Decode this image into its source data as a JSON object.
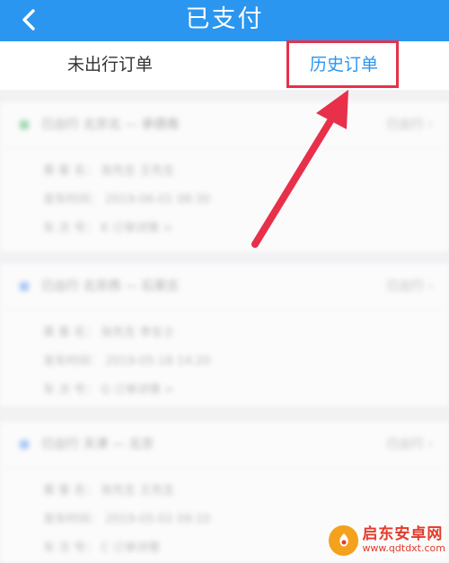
{
  "header": {
    "title": "已支付"
  },
  "tabs": [
    {
      "label": "未出行订单",
      "active": false
    },
    {
      "label": "历史订单",
      "active": true
    }
  ],
  "orders": [
    {
      "icon_color": "#9fd6b0",
      "route": "已出行  北京北 — 承德南",
      "status": "已出行 ›",
      "lines": [
        "乘 客 名：    张先生  王先生",
        "发车时间：    2019-06-01   08:30",
        "车 次 号：    K   订单详情 >"
      ]
    },
    {
      "icon_color": "#a9c6f7",
      "route": "已出行  北京西 — 石家庄",
      "status": "已出行 ›",
      "lines": [
        "乘 客 名：    张先生  李女士",
        "发车时间：    2019-05-18   14:20",
        "车 次 号：    G   订单详情 >"
      ]
    },
    {
      "icon_color": "#a9c6f7",
      "route": "已出行  天津 — 北京",
      "status": "已出行 ›",
      "lines": [
        "乘 客 名：    张先生  王先生",
        "发车时间：    2019-05-02   09:10",
        "车 次 号：    C   订单详情"
      ]
    }
  ],
  "watermark": {
    "name": "启东安卓网",
    "url": "www.qdtdxt.com"
  },
  "colors": {
    "accent": "#2a96f0",
    "highlight": "#e8304a"
  }
}
